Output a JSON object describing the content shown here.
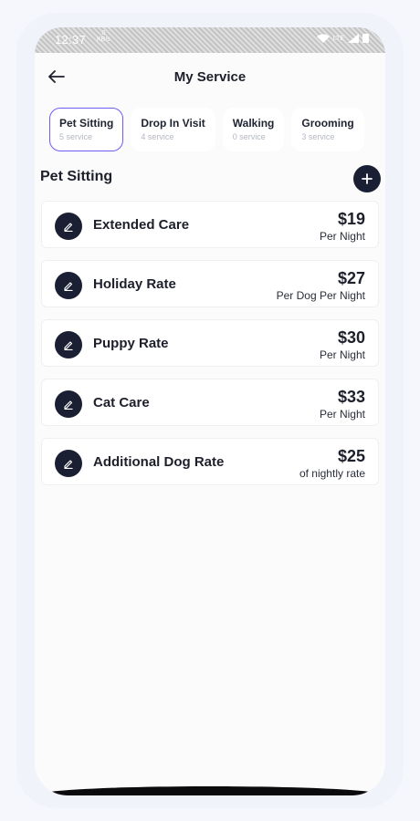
{
  "status_bar": {
    "time": "12:37",
    "net_speed_value": "0",
    "net_speed_unit": "KB/s",
    "lte_label": "LTE"
  },
  "header": {
    "title": "My Service"
  },
  "tabs": [
    {
      "label": "Pet Sitting",
      "count": "5 service",
      "active": true
    },
    {
      "label": "Drop In Visit",
      "count": "4 service",
      "active": false
    },
    {
      "label": "Walking",
      "count": "0 service",
      "active": false
    },
    {
      "label": "Grooming",
      "count": "3 service",
      "active": false
    }
  ],
  "section": {
    "title": "Pet Sitting"
  },
  "services": [
    {
      "name": "Extended Care",
      "price": "$19",
      "unit": "Per Night"
    },
    {
      "name": "Holiday Rate",
      "price": "$27",
      "unit": "Per Dog Per Night"
    },
    {
      "name": "Puppy Rate",
      "price": "$30",
      "unit": "Per Night"
    },
    {
      "name": "Cat Care",
      "price": "$33",
      "unit": "Per Night"
    },
    {
      "name": "Additional Dog Rate",
      "price": "$25",
      "unit": "of nightly rate"
    }
  ],
  "colors": {
    "accent": "#6b5cf6",
    "dark": "#1b1f33",
    "background": "#fbfbfc"
  },
  "icons": {
    "back": "arrow-left-icon",
    "add": "plus-icon",
    "edit": "pencil-icon"
  }
}
